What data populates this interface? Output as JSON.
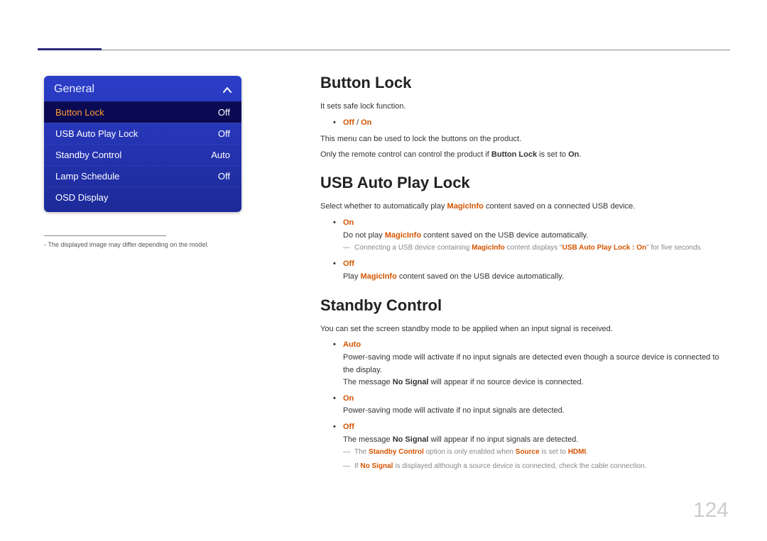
{
  "pageNumber": "124",
  "osd": {
    "title": "General",
    "items": [
      {
        "label": "Button Lock",
        "value": "Off",
        "selected": true
      },
      {
        "label": "USB Auto Play Lock",
        "value": "Off",
        "selected": false
      },
      {
        "label": "Standby Control",
        "value": "Auto",
        "selected": false
      },
      {
        "label": "Lamp Schedule",
        "value": "Off",
        "selected": false
      },
      {
        "label": "OSD Display",
        "value": "",
        "selected": false
      }
    ]
  },
  "sideNote": {
    "text": "The displayed image may differ depending on the model."
  },
  "sections": {
    "buttonLock": {
      "heading": "Button Lock",
      "line1": "It sets safe lock function.",
      "opt_off": "Off",
      "opt_sep": " / ",
      "opt_on": "On",
      "line2": "This menu can be used to lock the buttons on the product.",
      "line3_pre": "Only the remote control can control the product if ",
      "line3_bold": "Button Lock",
      "line3_mid": " is set to ",
      "line3_on": "On",
      "line3_post": "."
    },
    "usbLock": {
      "heading": "USB Auto Play Lock",
      "line1_pre": "Select whether to automatically play ",
      "line1_mi": "MagicInfo",
      "line1_post": " content saved on a connected USB device.",
      "onLabel": "On",
      "onDesc_pre": "Do not play ",
      "onDesc_mi": "MagicInfo",
      "onDesc_post": " content saved on the USB device automatically.",
      "dash_pre": "Connecting a USB device containing ",
      "dash_mi": "MagicInfo",
      "dash_mid": " content displays \"",
      "dash_q": "USB Auto Play Lock : On",
      "dash_post": "\" for five seconds.",
      "offLabel": "Off",
      "offDesc_pre": "Play ",
      "offDesc_mi": "MagicInfo",
      "offDesc_post": " content saved on the USB device automatically."
    },
    "standby": {
      "heading": "Standby Control",
      "line1": "You can set the screen standby mode to be applied when an input signal is received.",
      "autoLabel": "Auto",
      "autoDesc": "Power-saving mode will activate if no input signals are detected even though a source device is connected to the display.",
      "autoMsg_pre": "The message ",
      "autoMsg_ns": "No Signal",
      "autoMsg_post": " will appear if no source device is connected.",
      "onLabel": "On",
      "onDesc": "Power-saving mode will activate if no input signals are detected.",
      "offLabel": "Off",
      "offMsg_pre": "The message ",
      "offMsg_ns": "No Signal",
      "offMsg_post": " will appear if no input signals are detected.",
      "dash1_pre": "The ",
      "dash1_sc": "Standby Control",
      "dash1_mid": " option is only enabled when ",
      "dash1_src": "Source",
      "dash1_mid2": " is set to ",
      "dash1_hdmi": "HDMI",
      "dash1_post": ".",
      "dash2_pre": "If ",
      "dash2_ns": "No Signal",
      "dash2_post": " is displayed although a source device is connected, check the cable connection."
    }
  }
}
